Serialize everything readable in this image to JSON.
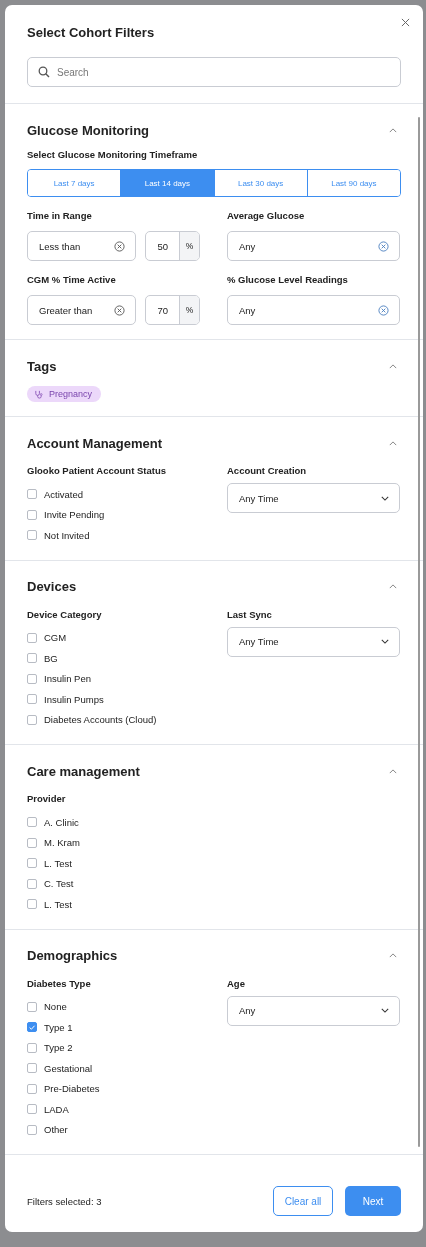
{
  "dialog": {
    "title": "Select Cohort Filters",
    "search": {
      "placeholder": "Search"
    }
  },
  "sections": [
    {
      "kind": "glucose",
      "title": "Glucose Monitoring",
      "expanded": true,
      "timeframe_label": "Select Glucose Monitoring Timeframe",
      "timeframes": [
        {
          "label": "Last 7 days",
          "selected": false
        },
        {
          "label": "Last 14 days",
          "selected": true
        },
        {
          "label": "Last 30 days",
          "selected": false
        },
        {
          "label": "Last 90 days",
          "selected": false
        }
      ],
      "fields": [
        {
          "kind": "compare",
          "label": "Time in Range",
          "operator": "Less than",
          "value": "50",
          "unit": "%"
        },
        {
          "kind": "select",
          "label": "Average Glucose",
          "value": "Any"
        },
        {
          "kind": "compare",
          "label": "CGM % Time Active",
          "operator": "Greater than",
          "value": "70",
          "unit": "%"
        },
        {
          "kind": "select",
          "label": "% Glucose Level Readings",
          "value": "Any"
        }
      ]
    },
    {
      "kind": "tags",
      "title": "Tags",
      "expanded": true,
      "tags": [
        "Pregnancy"
      ]
    },
    {
      "kind": "filters",
      "title": "Account Management",
      "expanded": true,
      "checklist": {
        "label": "Glooko Patient Account Status",
        "options": [
          {
            "label": "Activated",
            "checked": false
          },
          {
            "label": "Invite Pending",
            "checked": false
          },
          {
            "label": "Not Invited",
            "checked": false
          }
        ]
      },
      "dropdown": {
        "label": "Account Creation",
        "value": "Any Time"
      }
    },
    {
      "kind": "filters",
      "title": "Devices",
      "expanded": true,
      "checklist": {
        "label": "Device Category",
        "options": [
          {
            "label": "CGM",
            "checked": false
          },
          {
            "label": "BG",
            "checked": false
          },
          {
            "label": "Insulin Pen",
            "checked": false
          },
          {
            "label": "Insulin Pumps",
            "checked": false
          },
          {
            "label": "Diabetes Accounts (Cloud)",
            "checked": false
          }
        ]
      },
      "dropdown": {
        "label": "Last Sync",
        "value": "Any Time"
      }
    },
    {
      "kind": "filters",
      "title": "Care management",
      "expanded": true,
      "checklist": {
        "label": "Provider",
        "options": [
          {
            "label": "A. Clinic",
            "checked": false
          },
          {
            "label": "M. Kram",
            "checked": false
          },
          {
            "label": "L. Test",
            "checked": false
          },
          {
            "label": "C. Test",
            "checked": false
          },
          {
            "label": "L. Test",
            "checked": false
          }
        ]
      }
    },
    {
      "kind": "filters",
      "title": "Demographics",
      "expanded": true,
      "checklist": {
        "label": "Diabetes Type",
        "options": [
          {
            "label": "None",
            "checked": false
          },
          {
            "label": "Type 1",
            "checked": true
          },
          {
            "label": "Type 2",
            "checked": false
          },
          {
            "label": "Gestational",
            "checked": false
          },
          {
            "label": "Pre-Diabetes",
            "checked": false
          },
          {
            "label": "LADA",
            "checked": false
          },
          {
            "label": "Other",
            "checked": false
          }
        ]
      },
      "dropdown": {
        "label": "Age",
        "value": "Any"
      }
    }
  ],
  "footer": {
    "summary": "Filters selected: 3",
    "buttons": [
      {
        "kind": "secondary",
        "label": "Clear all"
      },
      {
        "kind": "primary",
        "label": "Next"
      }
    ]
  }
}
